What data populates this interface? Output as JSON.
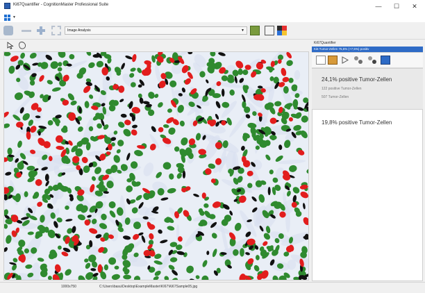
{
  "window": {
    "title": "Ki67Quantifier - CognitionMaster Professional Suite",
    "buttons": [
      "—",
      "☐",
      "✕"
    ]
  },
  "toolbar": {
    "analysis_value": "Image Analysis"
  },
  "sidebar": {
    "title": "Ki67Quantifier",
    "tab_label": "Ki6 Tumor-Zellen 75,5% (+7,5%) positiv"
  },
  "results": [
    {
      "main": "24,1% positive Tumor-Zellen",
      "sub": [
        "122 positive Tumor-Zellen",
        "507 Tumor-Zellen"
      ]
    },
    {
      "main": "19,8% positive Tumor-Zellen"
    }
  ],
  "status": {
    "dimensions": "1000x750",
    "path": "C:\\Users\\basu\\Desktop\\ExampleMaster\\KI67\\Ki67Sample05.jpg"
  },
  "image": {
    "positive_color": "#e21d1d",
    "negative_color": "#2f8a2f",
    "other_color": "#111111",
    "background_color": "#e9eef6",
    "stain_color": "#d8dff0"
  },
  "colors": {
    "accent_blue": "#2e6bc6",
    "window_bg": "#f0f0f0"
  }
}
